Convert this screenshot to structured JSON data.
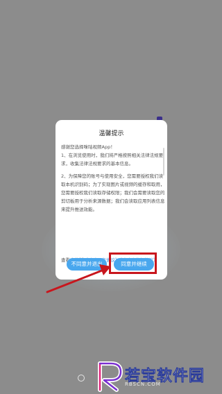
{
  "dialog": {
    "title": "温馨提示",
    "greeting": "感谢您选择咪咕视频App！",
    "para1": "1、在浏览使用时，我们将严格按照相关法律法规要求，收集法律法规要求的基本信息。",
    "para2": "2、为保障您的账号与使用安全，您需要授权我们读取本机识别码；为了实现图片或视频的缓存和取用，您需要授权我们读取存储权限；我们会需要读取您的剪切板用于分析来源数据；我们会读取应用列表信息来提升推送效能。",
    "agreement_prefix": "查看完整版",
    "service_link": "《咪咕服务协议》",
    "privacy_link": "《咪咕隐私权协议》"
  },
  "buttons": {
    "decline": "不同意并退出",
    "accept": "同意并继续"
  },
  "watermark": {
    "name": "若宝软件园",
    "url": "RBSCN.COM"
  },
  "colors": {
    "button_blue": "#49a7ee",
    "highlight_red": "#c8161d",
    "link_blue": "#3a8dde"
  }
}
